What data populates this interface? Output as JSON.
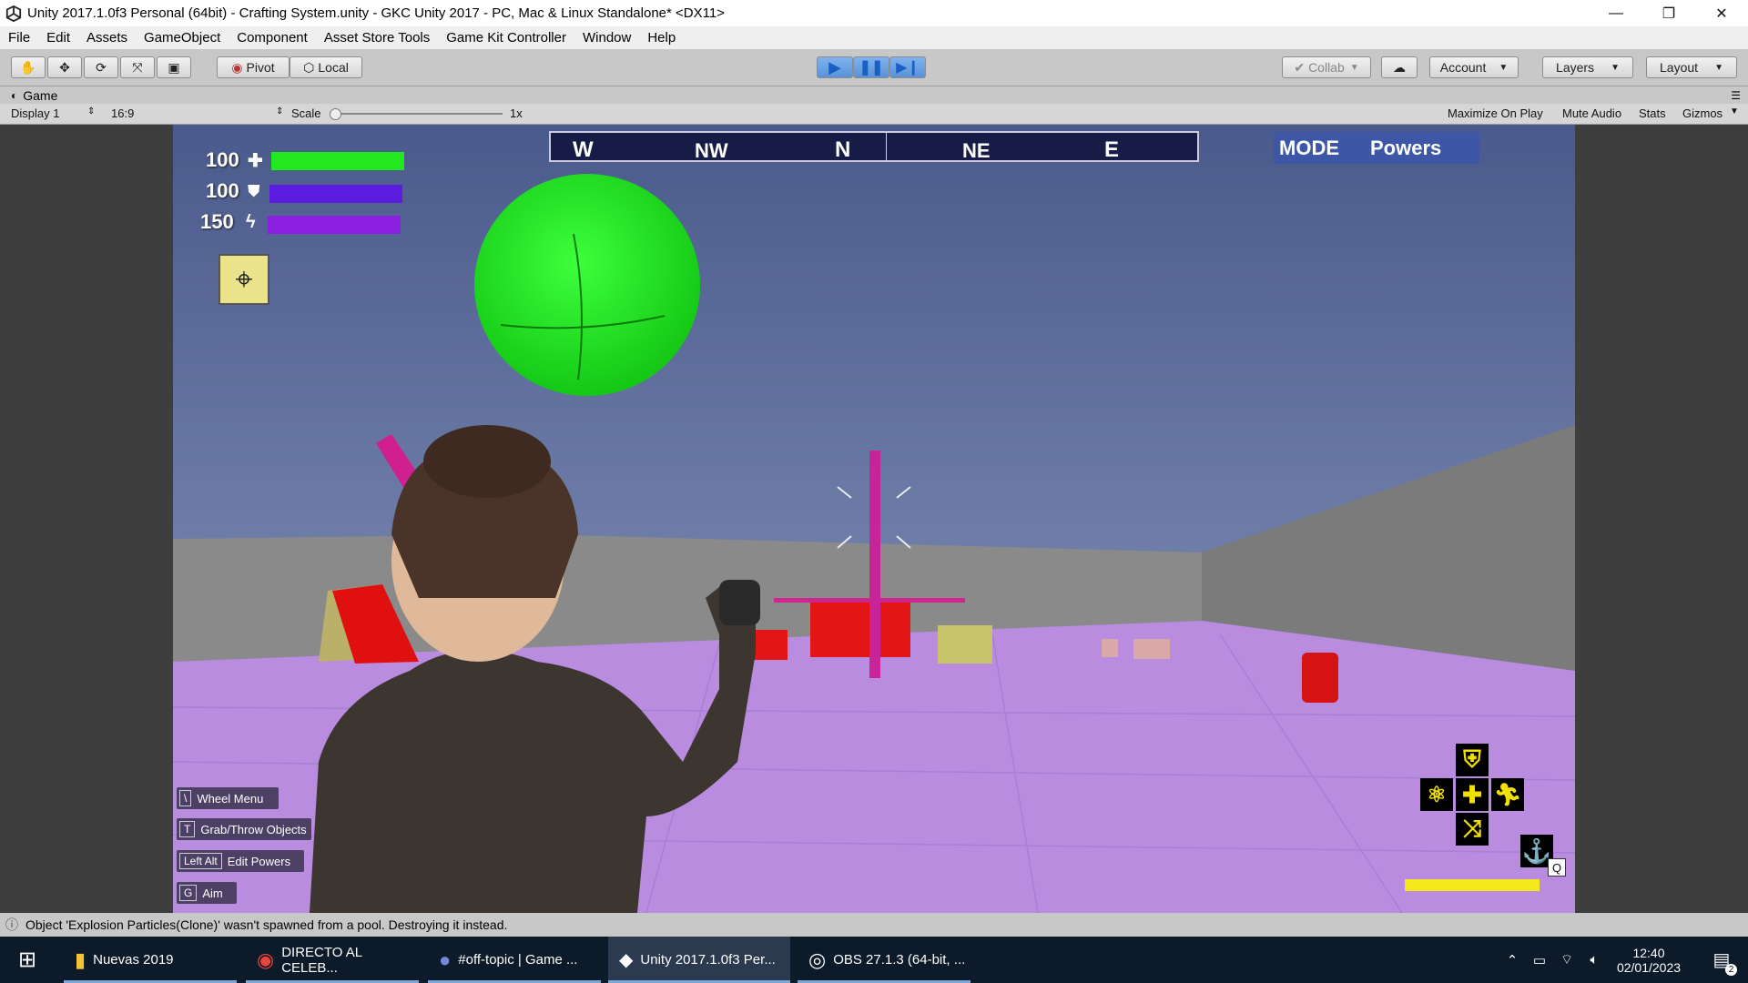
{
  "window": {
    "title": "Unity 2017.1.0f3 Personal (64bit) - Crafting System.unity - GKC Unity 2017 - PC, Mac & Linux Standalone* <DX11>"
  },
  "menu": [
    "File",
    "Edit",
    "Assets",
    "GameObject",
    "Component",
    "Asset Store Tools",
    "Game Kit Controller",
    "Window",
    "Help"
  ],
  "toolbar": {
    "pivot": "Pivot",
    "local": "Local",
    "collab": "Collab",
    "account": "Account",
    "layers": "Layers",
    "layout": "Layout"
  },
  "tabs": {
    "game": "Game"
  },
  "gamebar": {
    "display": "Display 1",
    "aspect": "16:9",
    "scale_label": "Scale",
    "scale_value": "1x",
    "maximize": "Maximize On Play",
    "mute": "Mute Audio",
    "stats": "Stats",
    "gizmos": "Gizmos"
  },
  "hud": {
    "health": "100",
    "shield": "100",
    "energy": "150",
    "health_fill": 1.0,
    "shield_fill": 1.0,
    "energy_fill": 1.0,
    "colors": {
      "health": "#22e81e",
      "shield": "#5b1de0",
      "energy": "#8b1fe0"
    },
    "compass": [
      "W",
      "NW",
      "N",
      "NE",
      "E"
    ],
    "mode_label": "MODE",
    "mode_value": "Powers",
    "hints": [
      {
        "key": "\\",
        "label": "Wheel Menu"
      },
      {
        "key": "T",
        "label": "Grab/Throw Objects"
      },
      {
        "key": "Left Alt",
        "label": "Edit Powers"
      },
      {
        "key": "G",
        "label": "Aim"
      }
    ],
    "power_key": "Q",
    "power_fill": 1.0
  },
  "status": {
    "message": "Object 'Explosion Particles(Clone)' wasn't spawned from a pool. Destroying it instead."
  },
  "taskbar": {
    "items": [
      "Nuevas 2019",
      "DIRECTO AL CELEB...",
      "#off-topic | Game ...",
      "Unity 2017.1.0f3 Per...",
      "OBS 27.1.3 (64-bit, ..."
    ],
    "time": "12:40",
    "date": "02/01/2023",
    "notif_count": "2"
  }
}
